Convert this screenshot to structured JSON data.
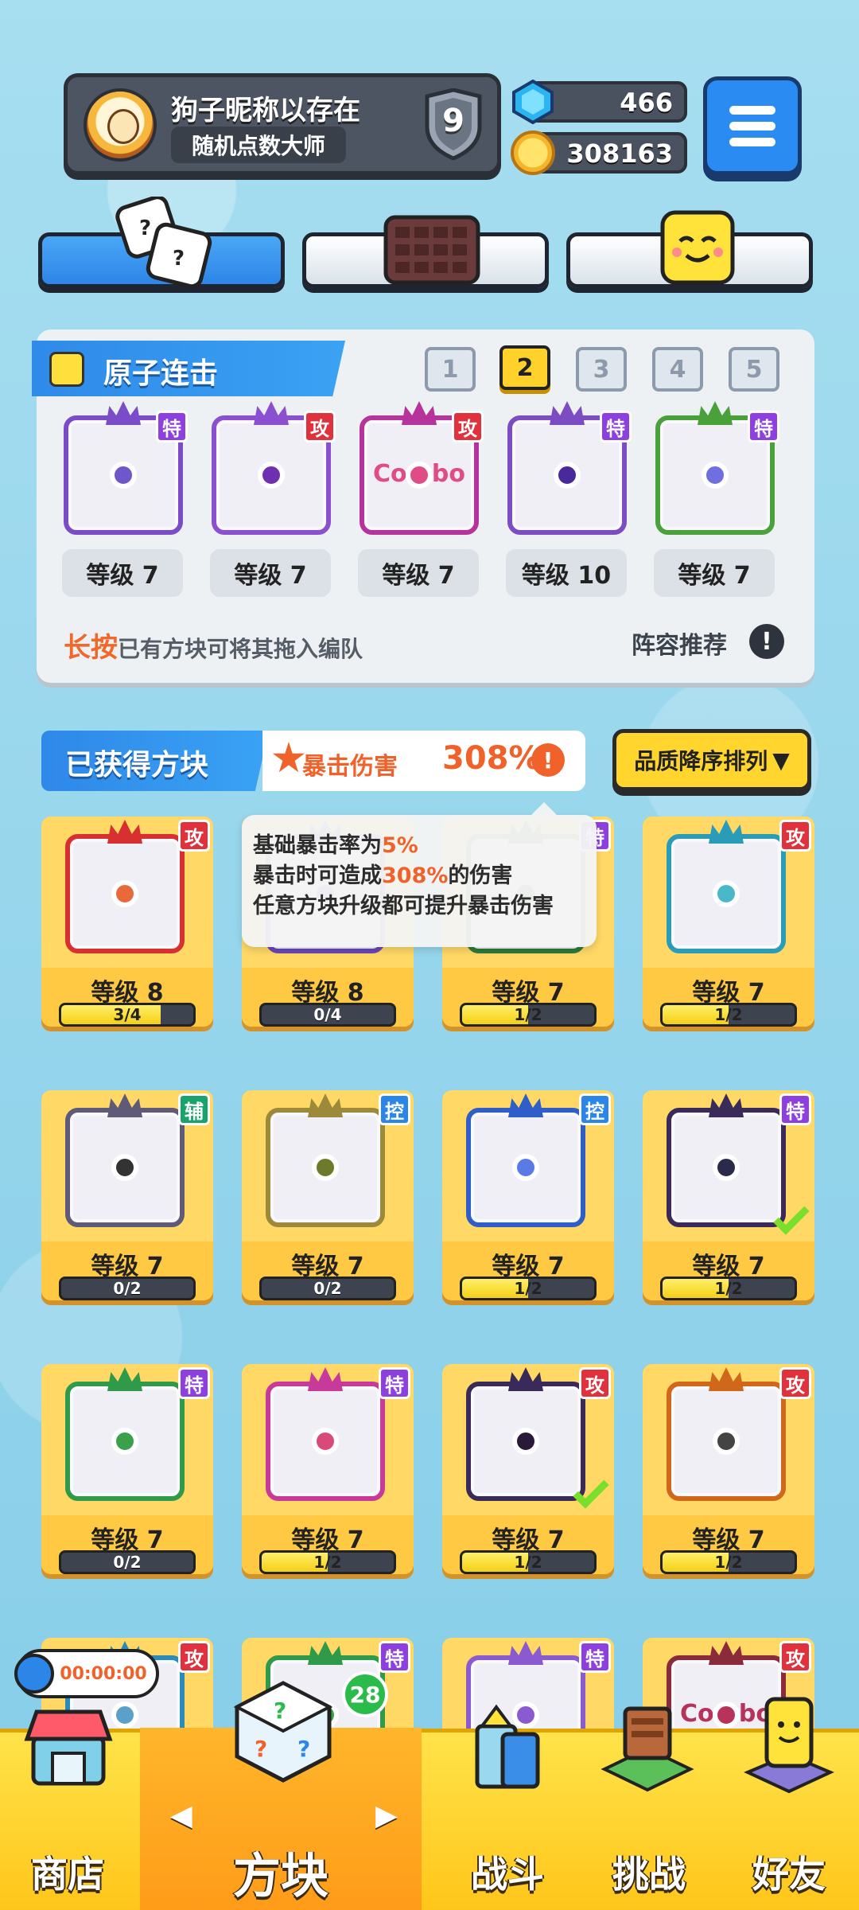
{
  "profile": {
    "name": "狗子昵称以存在",
    "title": "随机点数大师",
    "rank": "9"
  },
  "currency": {
    "gems": "466",
    "coins": "308163"
  },
  "deck": {
    "title": "原子连击",
    "pages": [
      "1",
      "2",
      "3",
      "4",
      "5"
    ],
    "active_page": "2",
    "slots": [
      {
        "type": "特",
        "level": "等级 7",
        "color": "#7a4cc7",
        "core": "#6e57c9"
      },
      {
        "type": "攻",
        "level": "等级 7",
        "color": "#8a50d0",
        "core": "#6f2fb0"
      },
      {
        "type": "攻",
        "level": "等级 7",
        "color": "#b5339a",
        "core": "#e04c86",
        "text": "Combo"
      },
      {
        "type": "特",
        "level": "等级 10",
        "color": "#7b4cc2",
        "core": "#4a2a9a"
      },
      {
        "type": "特",
        "level": "等级 7",
        "color": "#4aa13c",
        "core": "#6f6fe0"
      }
    ],
    "hint_emphasis": "长按",
    "hint_rest": "已有方块可将其拖入编队",
    "lineup_label": "阵容推荐",
    "info_glyph": "!"
  },
  "owned": {
    "title": "已获得方块",
    "crit_label": "暴击伤害",
    "crit_value": "308%",
    "sort_label": "品质降序排列",
    "sort_arrow": "▼",
    "tooltip": {
      "line1_prefix": "基础暴击率为",
      "line1_value": "5%",
      "line2_prefix": "暴击时可造成",
      "line2_value": "308%",
      "line2_suffix": "的伤害",
      "line3": "任意方块升级都可提升暴击伤害"
    },
    "cards": [
      {
        "type": "攻",
        "level": "等级 8",
        "progress": "3/4",
        "fill": 0.75,
        "color": "#d83030",
        "core": "#e86a3a",
        "checked": false
      },
      {
        "type": "",
        "level": "等级 8",
        "progress": "0/4",
        "fill": 0.0,
        "color": "#6a47b8",
        "core": "#6a47b8",
        "checked": false
      },
      {
        "type": "特",
        "level": "等级 7",
        "progress": "1/2",
        "fill": 0.5,
        "color": "#2f7a3a",
        "core": "#3a7a3a",
        "checked": false
      },
      {
        "type": "攻",
        "level": "等级 7",
        "progress": "1/2",
        "fill": 0.5,
        "color": "#2a9cb8",
        "core": "#49b8c8",
        "checked": false
      },
      {
        "type": "辅",
        "level": "等级 7",
        "progress": "0/2",
        "fill": 0.0,
        "color": "#5e5a78",
        "core": "#333333",
        "checked": false
      },
      {
        "type": "控",
        "level": "等级 7",
        "progress": "0/2",
        "fill": 0.0,
        "color": "#9c8a3a",
        "core": "#6d7a2a",
        "checked": false
      },
      {
        "type": "控",
        "level": "等级 7",
        "progress": "1/2",
        "fill": 0.5,
        "color": "#2f5ec8",
        "core": "#5a7ae8",
        "checked": false
      },
      {
        "type": "特",
        "level": "等级 7",
        "progress": "1/2",
        "fill": 0.5,
        "color": "#3a2a5a",
        "core": "#2a2a4a",
        "checked": true
      },
      {
        "type": "特",
        "level": "等级 7",
        "progress": "0/2",
        "fill": 0.0,
        "color": "#2f9a4a",
        "core": "#3aa04a",
        "checked": false
      },
      {
        "type": "特",
        "level": "等级 7",
        "progress": "1/2",
        "fill": 0.5,
        "color": "#c83a9a",
        "core": "#d84a7a",
        "checked": false
      },
      {
        "type": "攻",
        "level": "等级 7",
        "progress": "1/2",
        "fill": 0.5,
        "color": "#3a2a5a",
        "core": "#2a1a3a",
        "checked": true
      },
      {
        "type": "攻",
        "level": "等级 7",
        "progress": "1/2",
        "fill": 0.5,
        "color": "#d0671a",
        "core": "#444444",
        "checked": false
      },
      {
        "type": "攻",
        "level": "",
        "progress": "",
        "fill": 0.0,
        "color": "#2a8ab8",
        "core": "#5aa0c8",
        "checked": false
      },
      {
        "type": "特",
        "level": "",
        "progress": "",
        "fill": 0.0,
        "color": "#2f9a4a",
        "core": "#3aa04a",
        "checked": false
      },
      {
        "type": "特",
        "level": "",
        "progress": "",
        "fill": 0.0,
        "color": "#8a5ad0",
        "core": "#8a5ad0",
        "checked": false
      },
      {
        "type": "攻",
        "level": "",
        "progress": "",
        "fill": 0.0,
        "color": "#8a2a3a",
        "core": "#b8335a",
        "text": "Combo",
        "checked": false
      }
    ]
  },
  "timer": "00:00:00",
  "shop_badge": "28",
  "nav": {
    "shop": "商店",
    "blocks": "方块",
    "battle": "战斗",
    "challenge": "挑战",
    "friends": "好友",
    "left_arrow": "◀",
    "right_arrow": "▶"
  },
  "menu_icon": "hamburger-icon"
}
